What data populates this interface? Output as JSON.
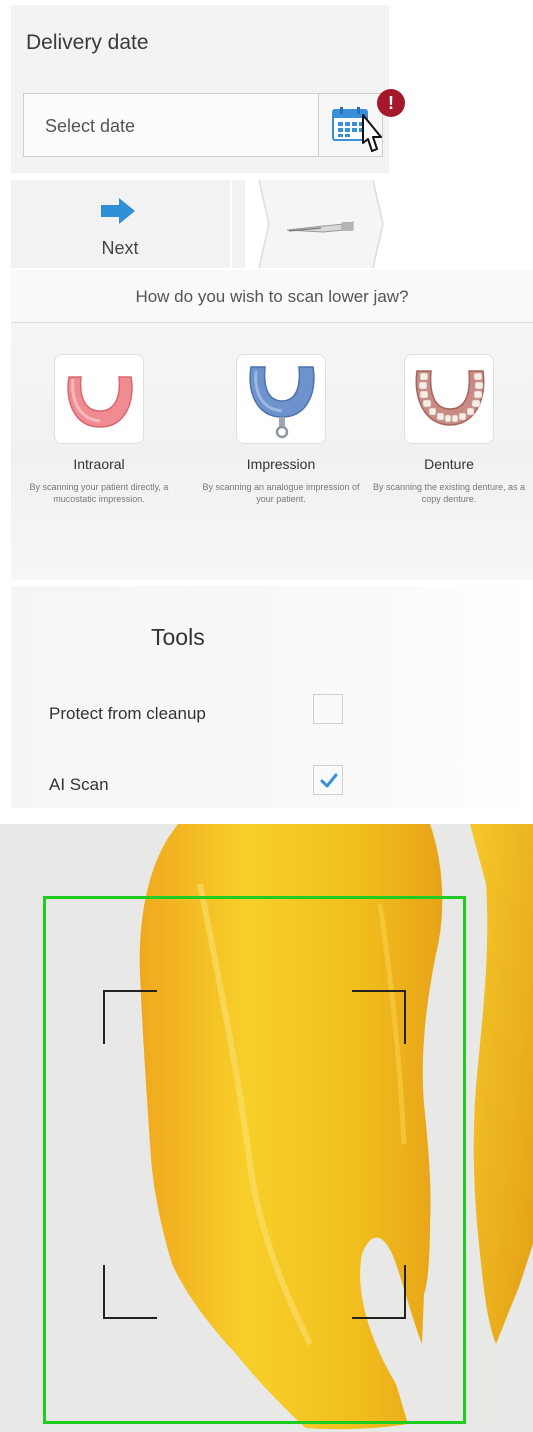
{
  "delivery": {
    "title": "Delivery date",
    "date_placeholder": "Select date",
    "alert_symbol": "!",
    "icons": [
      "calendar-icon",
      "alert-badge-icon",
      "pointer-cursor-icon"
    ]
  },
  "navigation": {
    "next_label": "Next",
    "icons": [
      "arrow-right-icon",
      "scanner-icon"
    ],
    "accent_color": "#2f8fd6"
  },
  "scan_choice": {
    "title": "How do you wish to scan lower jaw?",
    "options": [
      {
        "name": "Intraoral",
        "description": "By scanning your patient directly, a mucostatic impression.",
        "icon": "intraoral-jaw-icon"
      },
      {
        "name": "Impression",
        "description": "By scanning an analogue impression of your patient.",
        "icon": "impression-tray-icon"
      },
      {
        "name": "Denture",
        "description": "By scanning the existing denture, as a copy denture.",
        "icon": "denture-icon"
      }
    ]
  },
  "tools": {
    "title": "Tools",
    "items": [
      {
        "label": "Protect from cleanup",
        "checked": false
      },
      {
        "label": "AI Scan",
        "checked": true
      }
    ],
    "check_color": "#3a8fd9"
  },
  "scan_view": {
    "roi_color": "#1fcc22",
    "model_color": "#f2c21a"
  }
}
